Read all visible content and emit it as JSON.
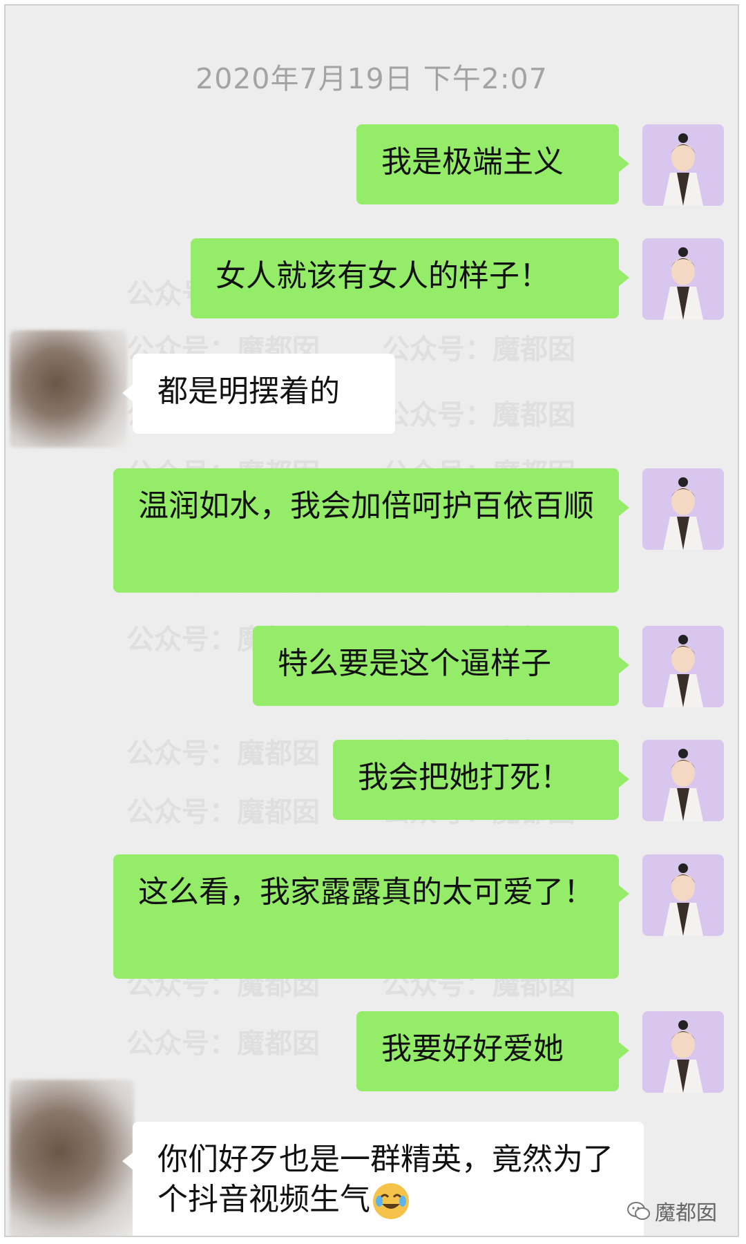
{
  "timestamp": "2020年7月19日 下午2:07",
  "watermark": "公众号：魔都囡",
  "messages": [
    {
      "sender": "me",
      "text": "我是极端主义"
    },
    {
      "sender": "me",
      "text": "女人就该有女人的样子！"
    },
    {
      "sender": "other",
      "text": "都是明摆着的"
    },
    {
      "sender": "me",
      "text": "温润如水，我会加倍呵护百依百顺"
    },
    {
      "sender": "me",
      "text": "特么要是这个逼样子"
    },
    {
      "sender": "me",
      "text": "我会把她打死！"
    },
    {
      "sender": "me",
      "text": "这么看，我家露露真的太可爱了！"
    },
    {
      "sender": "me",
      "text": "我要好好爱她"
    },
    {
      "sender": "other",
      "text": "你们好歹也是一群精英，竟然为了个抖音视频生气"
    }
  ],
  "emoji": "crying-laughing-emoji",
  "footer": {
    "brand": "魔都囡",
    "icon": "wechat-icon"
  },
  "colors": {
    "my_bubble": "#95ec69",
    "other_bubble": "#ffffff",
    "background": "#ededed",
    "timestamp": "#a3a3a3"
  }
}
